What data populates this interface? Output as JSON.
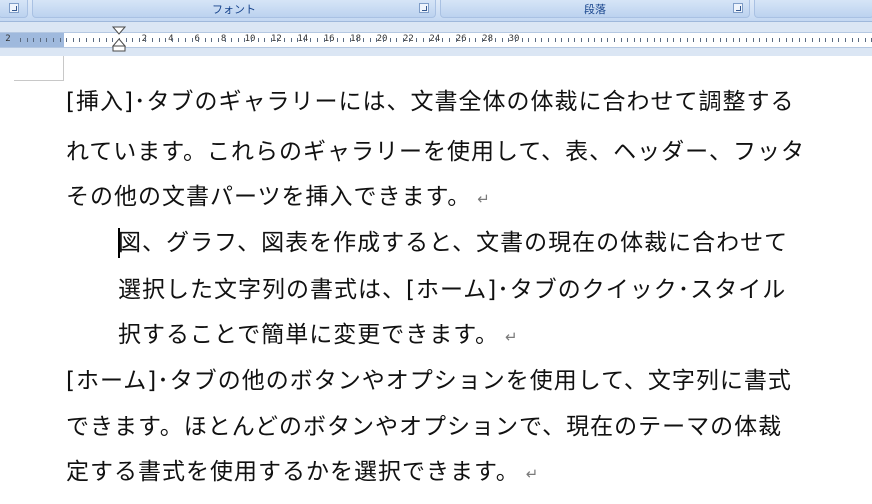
{
  "ribbon": {
    "groups": [
      {
        "label": ""
      },
      {
        "label": "フォント"
      },
      {
        "label": "段落"
      },
      {
        "label": ""
      }
    ]
  },
  "ruler": {
    "labels": [
      "2",
      "2",
      "4",
      "6",
      "8",
      "10",
      "12",
      "14",
      "16",
      "18",
      "20",
      "22",
      "24",
      "26",
      "28",
      "30"
    ]
  },
  "document": {
    "paragraph_mark": "↵",
    "lines": [
      "[挿入]･タブのギャラリーには、文書全体の体裁に合わせて調整する",
      "れています。これらのギャラリーを使用して、表、ヘッダー、フッタ",
      "その他の文書パーツを挿入できます。",
      "図、グラフ、図表を作成すると、文書の現在の体裁に合わせて",
      "選択した文字列の書式は、[ホーム]･タブのクイック･スタイル",
      "択することで簡単に変更できます。",
      "[ホーム]･タブの他のボタンやオプションを使用して、文字列に書式",
      "できます。ほとんどのボタンやオプションで、現在のテーマの体裁",
      "定する書式を使用するかを選択できます。"
    ]
  }
}
